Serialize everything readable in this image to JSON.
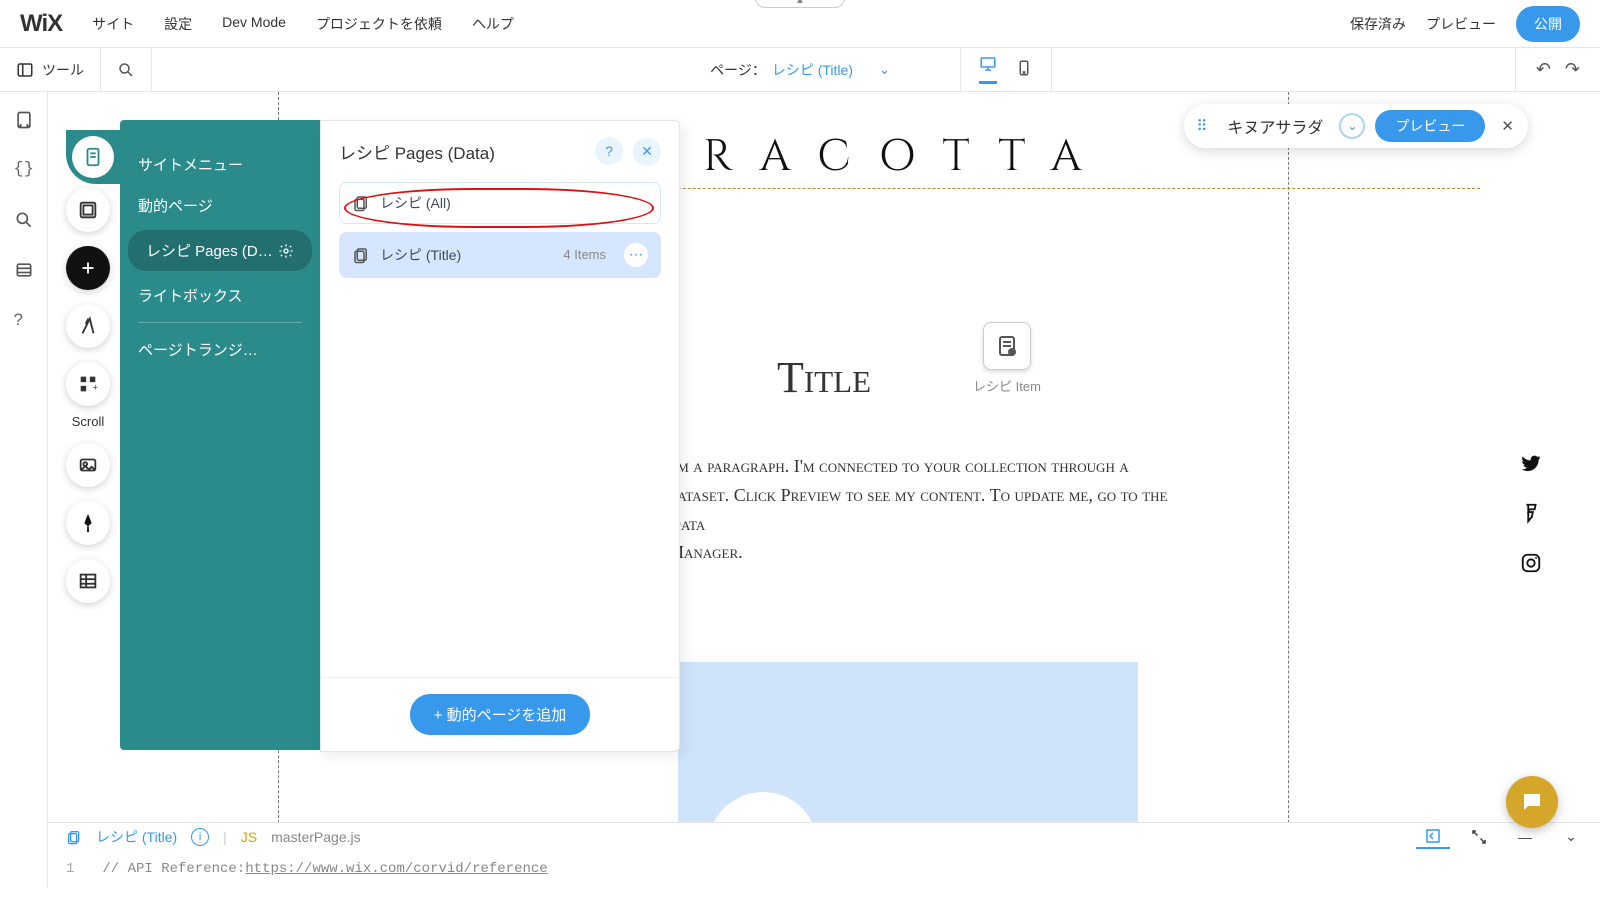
{
  "topbar": {
    "logo": "WiX",
    "menu": [
      "サイト",
      "設定",
      "Dev Mode",
      "プロジェクトを依頼",
      "ヘルプ"
    ],
    "saved": "保存済み",
    "preview": "プレビュー",
    "publish": "公開"
  },
  "secondbar": {
    "tools": "ツール",
    "page_prefix": "ページ：",
    "page_name": "レシピ (Title)"
  },
  "float": {
    "text": "キヌアサラダ",
    "preview": "プレビュー"
  },
  "sidepanel": {
    "items": [
      "サイトメニュー",
      "動的ページ",
      "レシピ Pages (D…",
      "ライトボックス",
      "ページトランジ…"
    ],
    "active_index": 2
  },
  "popout": {
    "title": "レシピ Pages (Data)",
    "rows": [
      {
        "label": "レシピ (All)",
        "count": ""
      },
      {
        "label": "レシピ (Title)",
        "count": "4 Items"
      }
    ],
    "add_button": "+ 動的ページを追加"
  },
  "canvas": {
    "brand": "TERRACOTTA",
    "title": "Title",
    "recipe_item": "レシピ Item",
    "paragraph": "I'm a paragraph. I'm connected to your collection through a dataset. Click Preview to see my content. To update me, go to the Data Manager."
  },
  "codebar": {
    "tab1": "レシピ (Title)",
    "tab2": "masterPage.js",
    "line_no": "1",
    "code_prefix": "// API Reference: ",
    "code_url": "https://www.wix.com/corvid/reference"
  }
}
